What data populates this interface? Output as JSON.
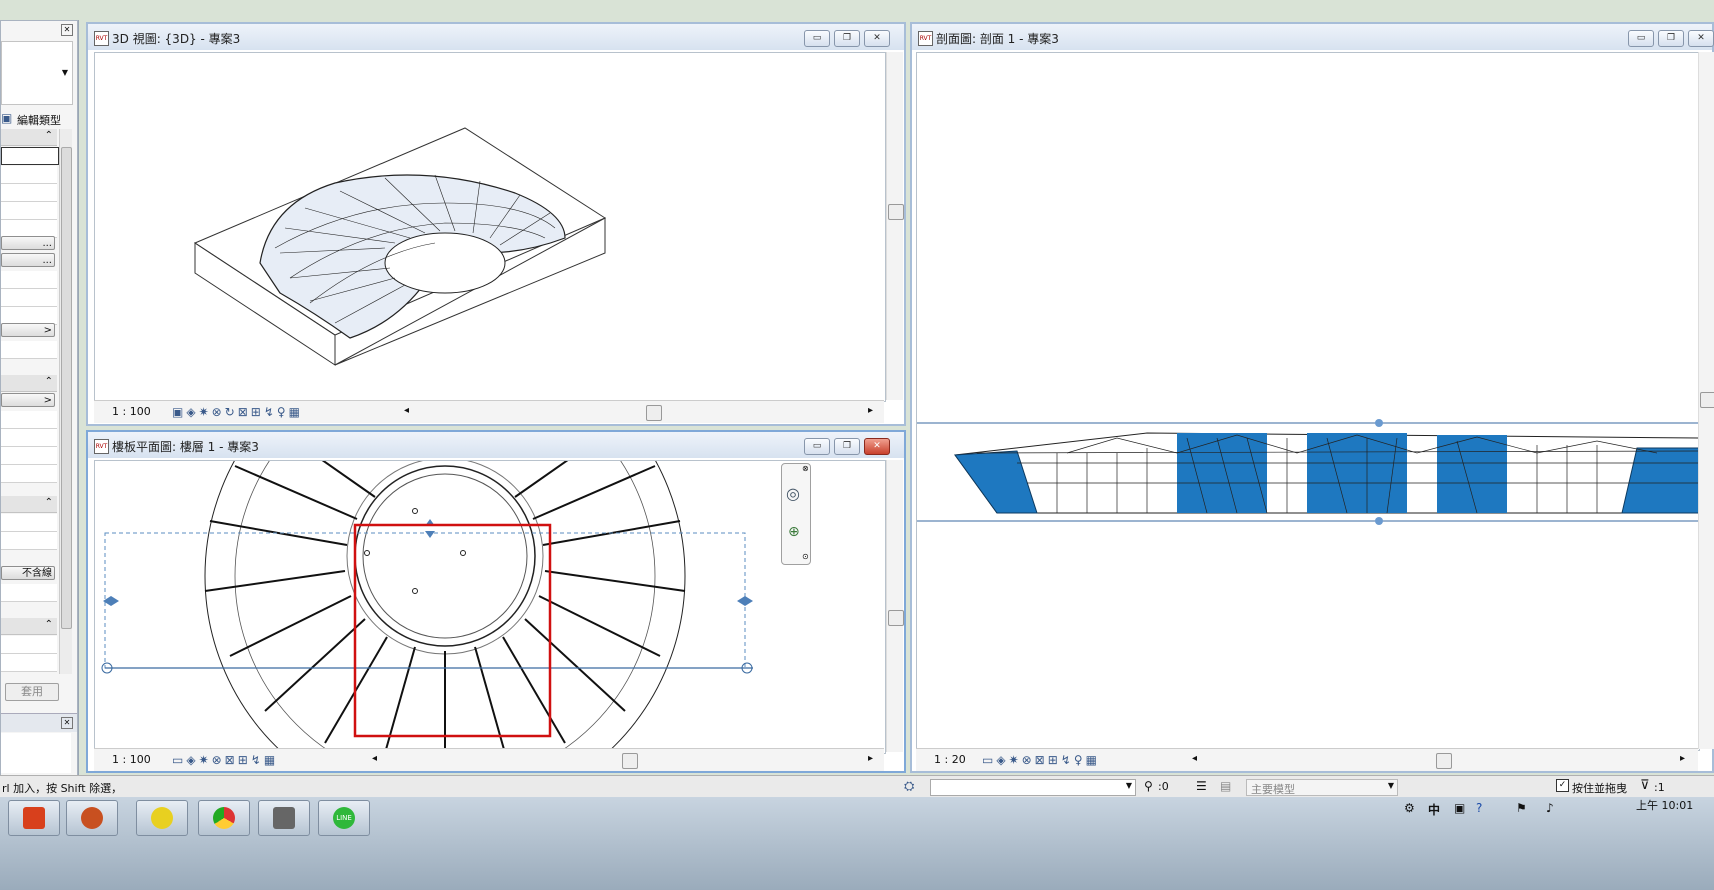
{
  "left_panel": {
    "edit_type_label": "編輯類型",
    "buttons": [
      "...",
      "...",
      ">",
      ">",
      "不含線"
    ],
    "apply_label": "套用"
  },
  "views": {
    "view3d": {
      "title": "3D 視圖: {3D} - 專案3",
      "scale": "1 : 100"
    },
    "floorplan": {
      "title": "樓板平面圖: 樓層 1 - 專案3",
      "scale": "1 : 100"
    },
    "section": {
      "title": "剖面圖: 剖面 1 - 專案3",
      "scale": "1 : 20"
    }
  },
  "window_buttons": {
    "minimize": "▭",
    "restore": "❐",
    "close": "✕"
  },
  "statusbar": {
    "hint": "rl 加入，按 Shift 除選，",
    "selection_count": ":0",
    "model_type": "主要模型",
    "drag_label": "按住並拖曳",
    "filter_count": ":1"
  },
  "taskbar": {
    "apps": [
      "adobe",
      "chrome-like",
      "qq",
      "chrome",
      "revit",
      "line"
    ],
    "line_label": "LINE",
    "tray_lang": "中",
    "clock": "上午 10:01"
  },
  "colors": {
    "accent_blue": "#1e78c0",
    "selection_red": "#d01010",
    "view_border": "#a7bdd8"
  }
}
